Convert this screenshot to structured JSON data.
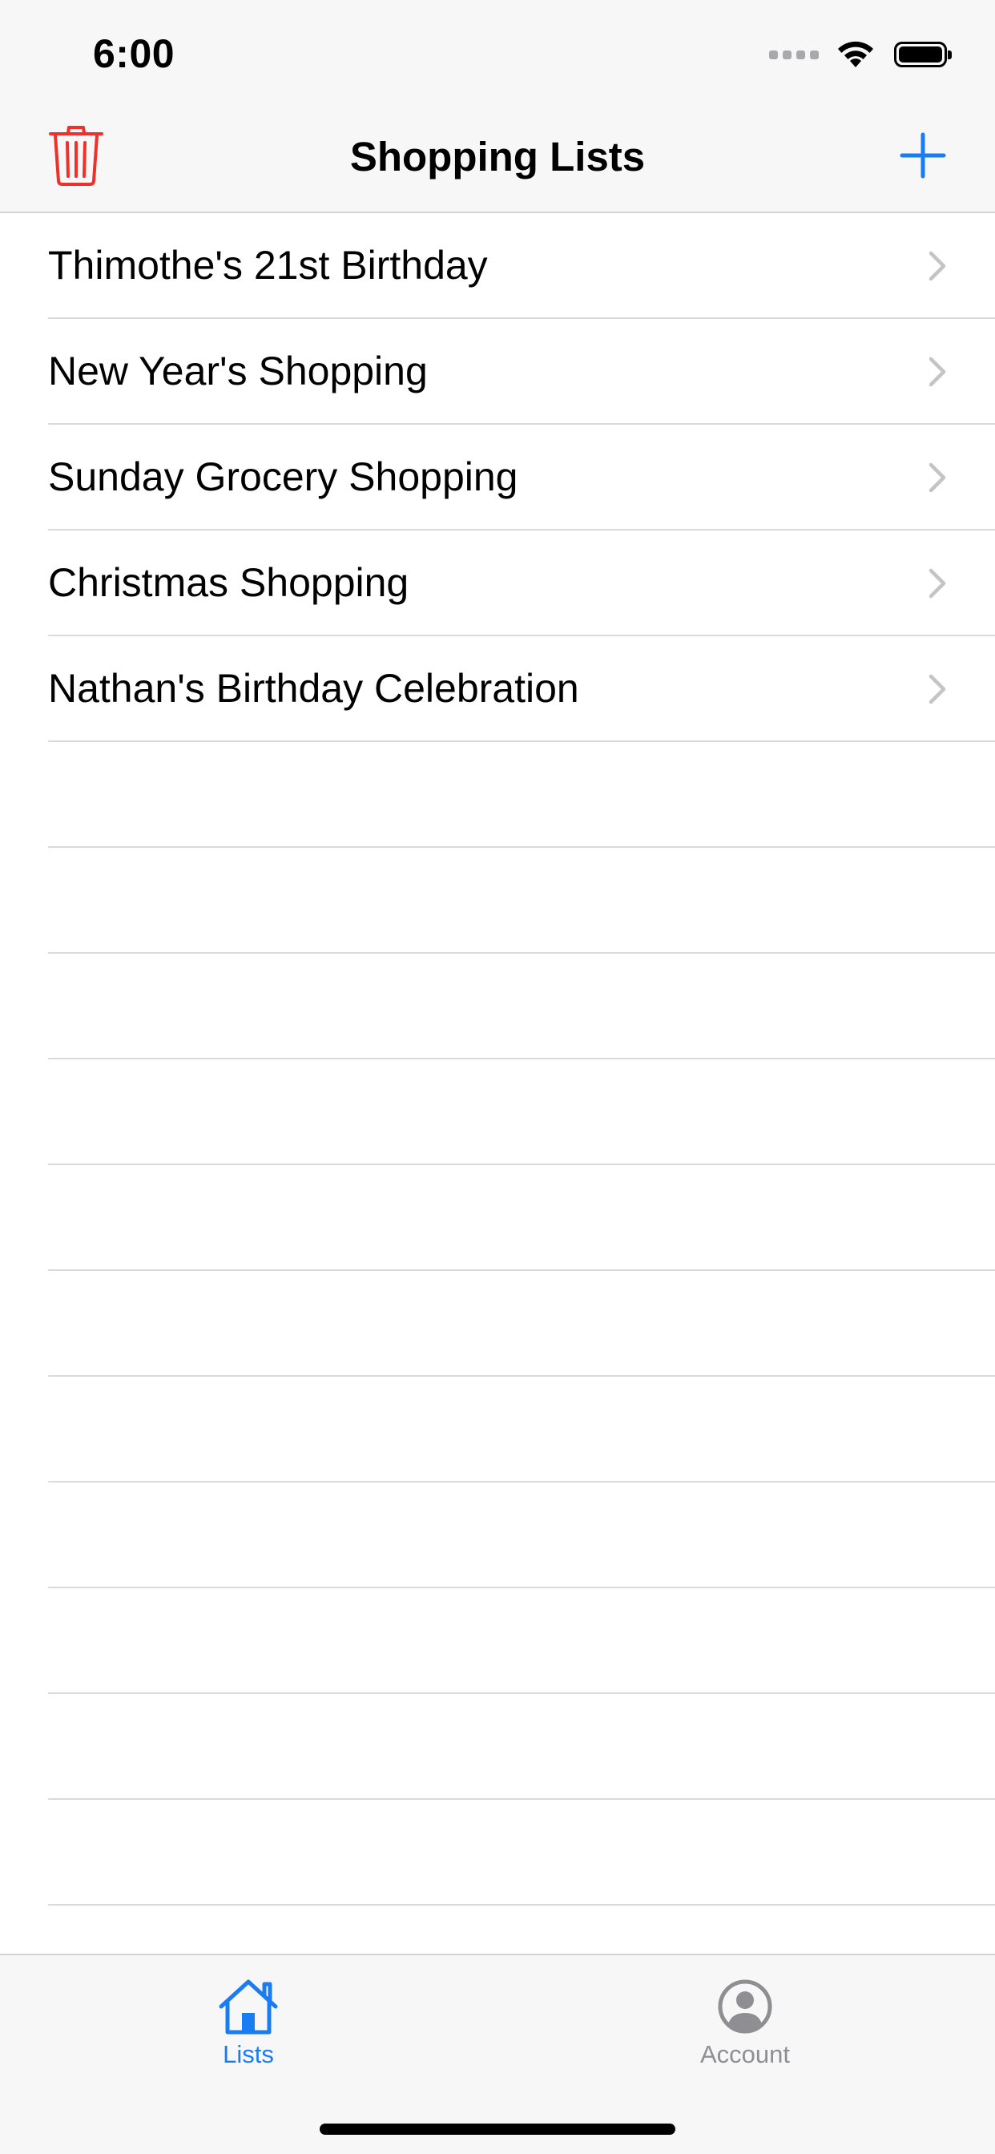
{
  "status_bar": {
    "time": "6:00"
  },
  "nav_bar": {
    "title": "Shopping Lists",
    "left_icon": "trash-icon",
    "right_icon": "plus-icon",
    "delete_color": "#f0302a",
    "accent_color": "#1a7cf2"
  },
  "lists": {
    "items": [
      {
        "label": "Thimothe's 21st Birthday"
      },
      {
        "label": "New Year's Shopping"
      },
      {
        "label": "Sunday Grocery Shopping"
      },
      {
        "label": "Christmas Shopping"
      },
      {
        "label": "Nathan's Birthday Celebration"
      }
    ],
    "chevron_icon": "chevron-right-icon"
  },
  "tab_bar": {
    "tabs": [
      {
        "label": "Lists",
        "icon": "house-icon",
        "selected": true
      },
      {
        "label": "Account",
        "icon": "person-circle-icon",
        "selected": false
      }
    ],
    "selected_color": "#1a7cf2",
    "unselected_color": "#8e8e93"
  }
}
